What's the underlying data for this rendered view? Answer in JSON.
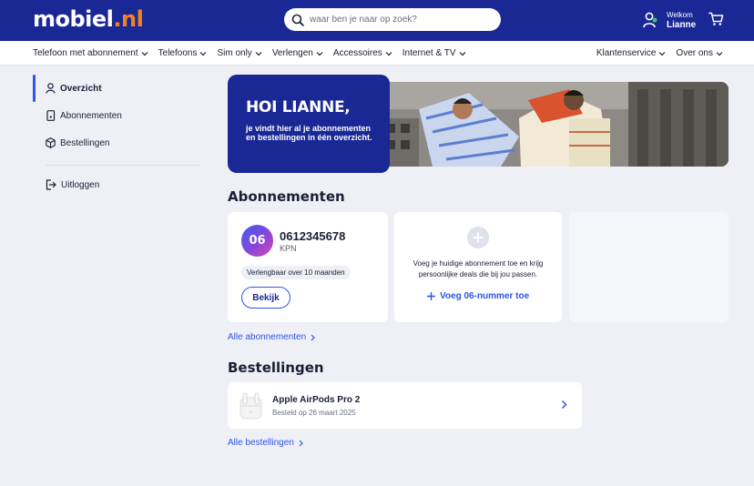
{
  "header": {
    "logo_main": "mobiel",
    "logo_tld": ".nl",
    "search_placeholder": "waar ben je naar op zoek?",
    "welcome": "Welkom",
    "user_name": "Lianne"
  },
  "nav": {
    "left": [
      {
        "label": "Telefoon met abonnement"
      },
      {
        "label": "Telefoons"
      },
      {
        "label": "Sim only"
      },
      {
        "label": "Verlengen"
      },
      {
        "label": "Accessoires"
      },
      {
        "label": "Internet & TV"
      }
    ],
    "right": [
      {
        "label": "Klantenservice"
      },
      {
        "label": "Over ons"
      }
    ]
  },
  "sidebar": {
    "items": [
      {
        "label": "Overzicht",
        "icon": "user-icon",
        "active": true
      },
      {
        "label": "Abonnementen",
        "icon": "phone-icon"
      },
      {
        "label": "Bestellingen",
        "icon": "box-icon"
      }
    ],
    "logout": "Uitloggen"
  },
  "hero": {
    "title": "HOI LIANNE,",
    "subtitle": "je vindt hier al je abonnementen en bestellingen in één overzicht."
  },
  "subscriptions": {
    "heading": "Abonnementen",
    "card": {
      "avatar": "06",
      "number": "0612345678",
      "provider": "KPN",
      "badge": "Verlengbaar over 10 maanden",
      "button": "Bekijk"
    },
    "add": {
      "text": "Voeg je huidige abonnement toe en krijg persoonlijke deals die bij jou passen.",
      "link": "Voeg 06-nummer toe"
    },
    "all_link": "Alle abonnementen"
  },
  "orders": {
    "heading": "Bestellingen",
    "items": [
      {
        "title": "Apple AirPods Pro 2",
        "date": "Besteld op 26 maart 2025"
      }
    ],
    "all_link": "Alle bestellingen"
  },
  "colors": {
    "brand_blue": "#1a2896",
    "accent_orange": "#f58220",
    "link_blue": "#2f55e4"
  }
}
